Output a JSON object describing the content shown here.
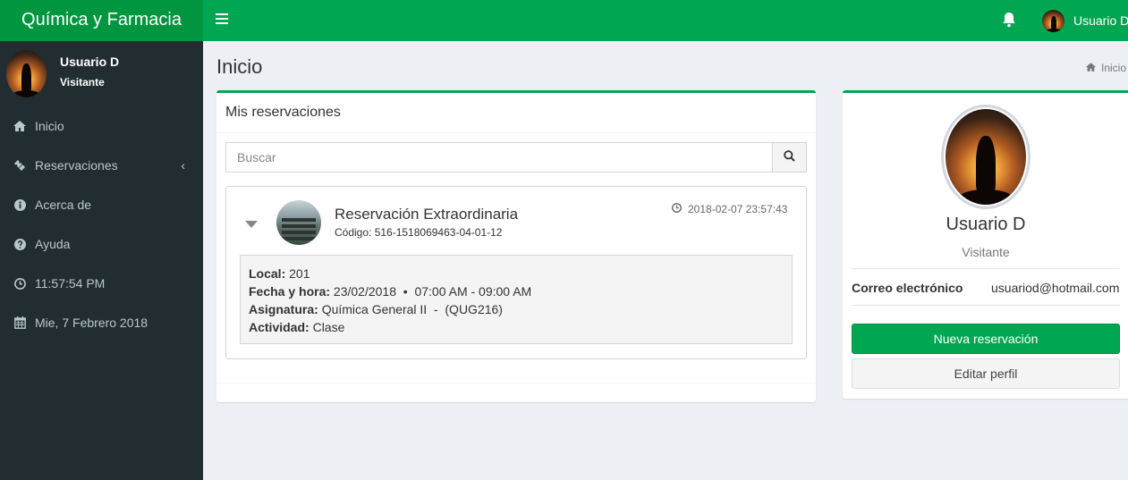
{
  "app": {
    "title": "Química y Farmacia"
  },
  "header": {
    "user_name": "Usuario D"
  },
  "sidebar": {
    "user": {
      "name": "Usuario D",
      "role": "Visitante"
    },
    "items": [
      {
        "label": "Inicio",
        "icon": "home-icon"
      },
      {
        "label": "Reservaciones",
        "icon": "ticket-icon"
      },
      {
        "label": "Acerca de",
        "icon": "info-icon"
      },
      {
        "label": "Ayuda",
        "icon": "question-icon"
      },
      {
        "label": "11:57:54 PM",
        "icon": "clock-icon"
      },
      {
        "label": "Mie, 7 Febrero 2018",
        "icon": "calendar-icon"
      }
    ]
  },
  "page": {
    "title": "Inicio",
    "breadcrumb": "Inicio"
  },
  "reservations": {
    "title": "Mis reservaciones",
    "search_placeholder": "Buscar",
    "items": [
      {
        "title": "Reservación Extraordinaria",
        "code": "Código: 516-1518069463-04-01-12",
        "timestamp": "2018-02-07 23:57:43",
        "local_label": "Local:",
        "local": "201",
        "datetime_label": "Fecha y hora:",
        "datetime": "23/02/2018  •  07:00 AM - 09:00 AM",
        "subject_label": "Asignatura:",
        "subject": "Química General II  -  (QUG216)",
        "activity_label": "Actividad:",
        "activity": "Clase"
      }
    ]
  },
  "profile": {
    "name": "Usuario D",
    "role": "Visitante",
    "email_label": "Correo electrónico",
    "email": "usuariod@hotmail.com",
    "new_reservation_label": "Nueva reservación",
    "edit_profile_label": "Editar perfil"
  },
  "colors": {
    "brand": "#00a651",
    "brand_dark": "#00953f",
    "sidebar_bg": "#222d32",
    "content_bg": "#ecf0f5"
  }
}
